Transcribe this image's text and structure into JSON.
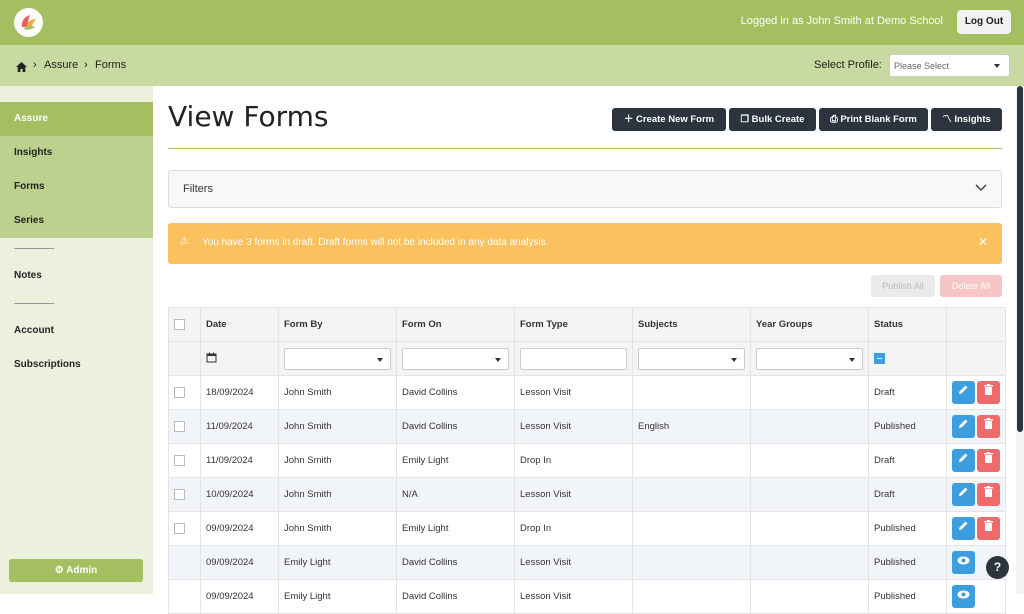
{
  "header": {
    "logged_in": "Logged in as John Smith at Demo School",
    "logout": "Log Out"
  },
  "breadcrumb": [
    "Assure",
    "Forms"
  ],
  "profile": {
    "label": "Select Profile:",
    "placeholder": "Please Select"
  },
  "sidebar": {
    "items": [
      "Assure",
      "Insights",
      "Forms",
      "Series",
      "Notes",
      "Account",
      "Subscriptions"
    ],
    "admin": "Admin"
  },
  "page": {
    "title": "View Forms",
    "buttons": [
      "Create New Form",
      "Bulk Create",
      "Print Blank Form",
      "Insights"
    ],
    "filters": "Filters",
    "alert": "You have 3 forms in draft. Draft forms will not be included in any data analysis.",
    "publish_all": "Publish All",
    "delete_all": "Delete All"
  },
  "table": {
    "headers": [
      "Date",
      "Form By",
      "Form On",
      "Form Type",
      "Subjects",
      "Year Groups",
      "Status"
    ],
    "rows": [
      {
        "date": "18/09/2024",
        "by": "John Smith",
        "on": "David Collins",
        "type": "Lesson Visit",
        "subjects": "",
        "year": "",
        "status": "Draft"
      },
      {
        "date": "11/09/2024",
        "by": "John Smith",
        "on": "David Collins",
        "type": "Lesson Visit",
        "subjects": "English",
        "year": "",
        "status": "Published"
      },
      {
        "date": "11/09/2024",
        "by": "John Smith",
        "on": "Emily Light",
        "type": "Drop In",
        "subjects": "",
        "year": "",
        "status": "Draft"
      },
      {
        "date": "10/09/2024",
        "by": "John Smith",
        "on": "N/A",
        "type": "Lesson Visit",
        "subjects": "",
        "year": "",
        "status": "Draft"
      },
      {
        "date": "09/09/2024",
        "by": "John Smith",
        "on": "Emily Light",
        "type": "Drop In",
        "subjects": "",
        "year": "",
        "status": "Published"
      },
      {
        "date": "09/09/2024",
        "by": "Emily Light",
        "on": "David Collins",
        "type": "Lesson Visit",
        "subjects": "",
        "year": "",
        "status": "Published"
      },
      {
        "date": "09/09/2024",
        "by": "Emily Light",
        "on": "David Collins",
        "type": "Lesson Visit",
        "subjects": "",
        "year": "",
        "status": "Published"
      }
    ]
  },
  "help": "?",
  "colors": {
    "brand": "#a3bf5f",
    "dark": "#2c343d",
    "warning": "#fbc15e",
    "edit": "#3c9ede",
    "delete": "#ef6b6b"
  }
}
